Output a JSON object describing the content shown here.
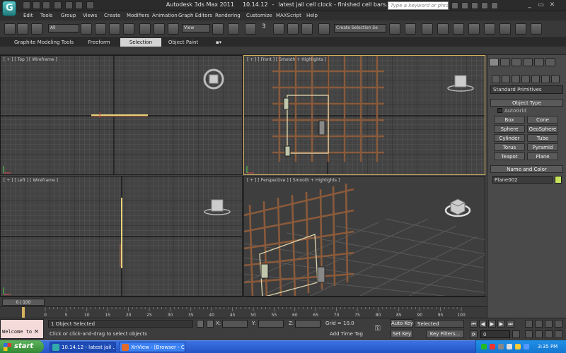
{
  "title": {
    "app": "Autodesk 3ds Max  2011",
    "date": "10.14.12",
    "doc": "latest jail cell clock - finished cell bars.max"
  },
  "search": {
    "placeholder": "Type a keyword or phrase"
  },
  "menu": [
    "Edit",
    "Tools",
    "Group",
    "Views",
    "Create",
    "Modifiers",
    "Animation",
    "Graph Editors",
    "Rendering",
    "Customize",
    "MAXScript",
    "Help"
  ],
  "toolbar": {
    "filter": "All",
    "refcoord": "View",
    "named_selection": "Create Selection Se",
    "spinner_label": "3"
  },
  "ribbon": {
    "tabs": [
      "Graphite Modeling Tools",
      "Freeform",
      "Selection",
      "Object Paint"
    ],
    "active_tab": "Selection"
  },
  "viewports": {
    "top": "[ + ] [ Top ] [ Wireframe ]",
    "front": "[ + ] [ Front ] [ Smooth + Highlights ]",
    "left": "[ + ] [ Left ] [ Wireframe ]",
    "persp": "[ + ] [ Perspective ] [ Smooth + Highlights ]"
  },
  "command_panel": {
    "category": "Standard Primitives",
    "object_type_title": "Object Type",
    "autogrid": "AutoGrid",
    "primitives": [
      "Box",
      "Cone",
      "Sphere",
      "GeoSphere",
      "Cylinder",
      "Tube",
      "Torus",
      "Pyramid",
      "Teapot",
      "Plane"
    ],
    "name_color_title": "Name and Color",
    "object_name": "Plane002",
    "object_color": "#c6e35c"
  },
  "timeline": {
    "frame_display": "0 / 100",
    "ticks": [
      "0",
      "5",
      "10",
      "15",
      "20",
      "25",
      "30",
      "35",
      "40",
      "45",
      "50",
      "55",
      "60",
      "65",
      "70",
      "75",
      "80",
      "85",
      "90",
      "95",
      "100"
    ]
  },
  "status": {
    "maxscript_text": "Welcome to M",
    "selection": "1 Object Selected",
    "prompt": "Click or click-and-drag to select objects",
    "x_label": "X:",
    "y_label": "Y:",
    "z_label": "Z:",
    "grid": "Grid = 10.0",
    "add_time_tag": "Add Time Tag",
    "auto_key": "Auto Key",
    "set_key": "Set Key",
    "key_mode": "Selected",
    "key_filters": "Key Filters...",
    "current_frame": "0"
  },
  "taskbar": {
    "start": "start",
    "tasks": [
      "10.14.12 - latest jail ...",
      "XnView - [Browser - C..."
    ],
    "clock": "3:35 PM"
  },
  "colors": {
    "accent_active_viewport": "#d6b160",
    "bars": "#8a5a3a"
  }
}
